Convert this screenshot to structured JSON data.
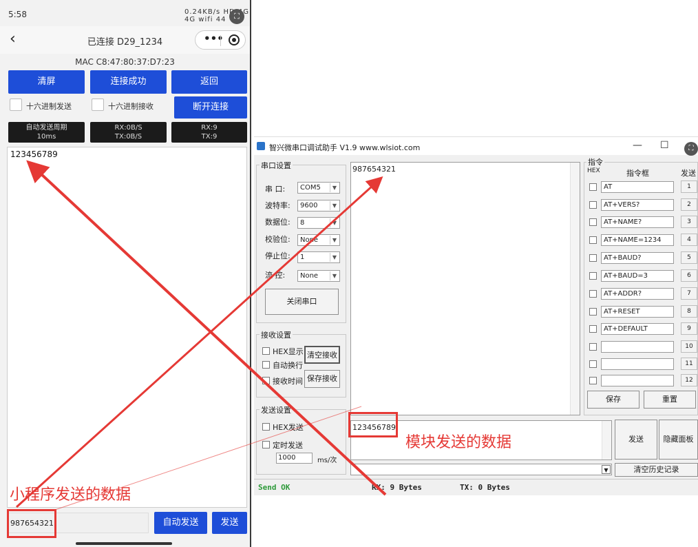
{
  "phone": {
    "status_time": "5:58",
    "status_icons": "0.24KB/s HD 4G 4G wifi 44",
    "back_icon": "‹",
    "nav_title": "已连接 D29_1234",
    "mac": "MAC C8:47:80:37:D7:23",
    "buttons": {
      "clear": "清屏",
      "connected": "连接成功",
      "back": "返回",
      "disconnect": "断开连接",
      "auto_send": "自动发送",
      "send": "发送"
    },
    "hex_send_label": "十六进制发送",
    "hex_recv_label": "十六进制接收",
    "auto_period_label": "自动发送周期",
    "auto_period_value": "10ms",
    "rate_rx": "RX:0B/S",
    "rate_tx": "TX:0B/S",
    "count_rx": "RX:9",
    "count_tx": "TX:9",
    "received_text": "123456789",
    "send_input_value": "987654321"
  },
  "window": {
    "title": "智兴微串口调试助手 V1.9   www.wlsiot.com",
    "serial_group_title": "串口设置",
    "port_label": "串  口:",
    "port_value": "COM5",
    "baud_label": "波特率:",
    "baud_value": "9600",
    "databits_label": "数据位:",
    "databits_value": "8",
    "parity_label": "校验位:",
    "parity_value": "None",
    "stopbits_label": "停止位:",
    "stopbits_value": "1",
    "flow_label": "流  控:",
    "flow_value": "None",
    "close_port_button": "关闭串口",
    "recv_group_title": "接收设置",
    "hex_display_label": "HEX显示",
    "auto_wrap_label": "自动换行",
    "recv_time_label": "接收时间",
    "clear_recv_button": "清空接收",
    "save_recv_button": "保存接收",
    "send_group_title": "发送设置",
    "hex_send_label": "HEX发送",
    "timed_send_label": "定时发送",
    "interval_value": "1000",
    "interval_unit": "ms/次",
    "received_text": "987654321",
    "send_text": "123456789",
    "cmd_group_title": "指令",
    "cmd_hex_header": "HEX",
    "cmd_box_header": "指令框",
    "cmd_send_header": "发送",
    "commands": [
      {
        "text": "AT",
        "num": "1"
      },
      {
        "text": "AT+VERS?",
        "num": "2"
      },
      {
        "text": "AT+NAME?",
        "num": "3"
      },
      {
        "text": "AT+NAME=1234",
        "num": "4"
      },
      {
        "text": "AT+BAUD?",
        "num": "5"
      },
      {
        "text": "AT+BAUD=3",
        "num": "6"
      },
      {
        "text": "AT+ADDR?",
        "num": "7"
      },
      {
        "text": "AT+RESET",
        "num": "8"
      },
      {
        "text": "AT+DEFAULT",
        "num": "9"
      },
      {
        "text": "",
        "num": "10"
      },
      {
        "text": "",
        "num": "11"
      },
      {
        "text": "",
        "num": "12"
      }
    ],
    "save_button": "保存",
    "reset_button": "重置",
    "send_button": "发送",
    "hide_panel_button": "隐藏面板",
    "clear_history_button": "清空历史记录",
    "status_send_ok": "Send OK",
    "status_rx": "RX: 9 Bytes",
    "status_tx": "TX: 0 Bytes"
  },
  "annotations": {
    "mini_program_label": "小程序发送的数据",
    "module_label": "模块发送的数据",
    "color": "#e53935"
  }
}
